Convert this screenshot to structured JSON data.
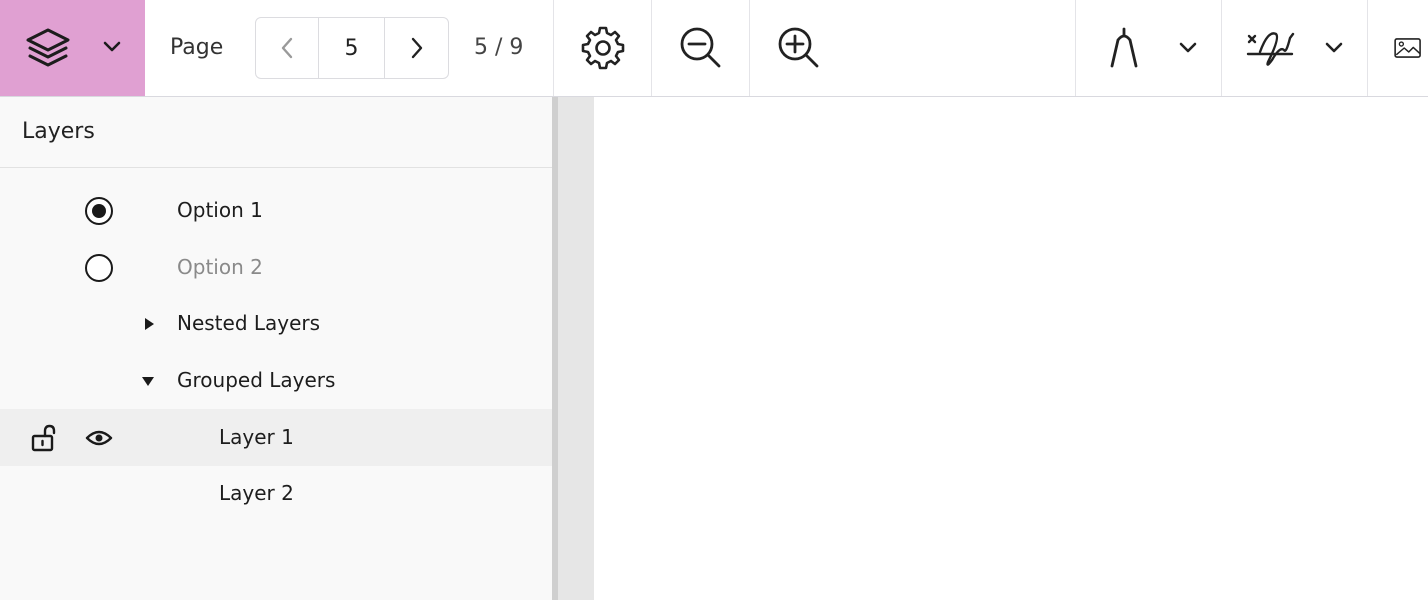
{
  "toolbar": {
    "layers_button": {
      "icon": "layers-icon",
      "color": "#e0a0d2"
    },
    "page_label": "Page",
    "page_input_value": "5",
    "page_count": "5 / 9",
    "icons": [
      "settings-icon",
      "zoom-out-icon",
      "zoom-in-icon",
      "ink-pen-icon",
      "signature-icon",
      "image-icon"
    ]
  },
  "sidebar": {
    "title": "Layers",
    "items": [
      {
        "label": "Option 1",
        "type": "radio",
        "checked": true
      },
      {
        "label": "Option 2",
        "type": "radio",
        "checked": false,
        "muted": true
      },
      {
        "label": "Nested Layers",
        "type": "group",
        "expanded": false
      },
      {
        "label": "Grouped Layers",
        "type": "group",
        "expanded": true
      },
      {
        "label": "Layer 1",
        "type": "layer",
        "selected": true,
        "locked": false,
        "visible": true
      },
      {
        "label": "Layer 2",
        "type": "layer",
        "selected": false
      }
    ]
  }
}
